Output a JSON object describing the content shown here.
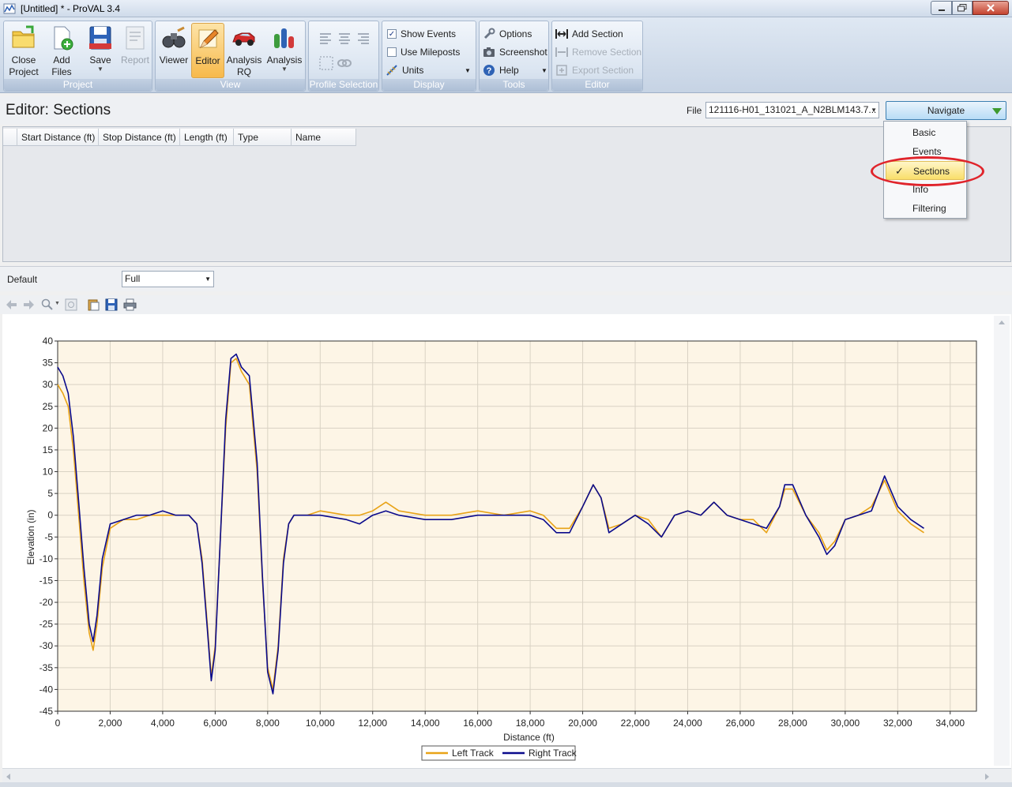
{
  "window": {
    "title": "[Untitled] * - ProVAL 3.4"
  },
  "ribbon": {
    "groups": {
      "project": "Project",
      "view": "View",
      "profile_selection": "Profile Selection",
      "display": "Display",
      "tools": "Tools",
      "editor": "Editor"
    },
    "close_project": [
      "Close",
      "Project"
    ],
    "add_files": "Add Files",
    "save": "Save",
    "report": "Report",
    "viewer": "Viewer",
    "editor": "Editor",
    "analysis_rq": [
      "Analysis",
      "RQ"
    ],
    "analysis": "Analysis",
    "show_events": "Show Events",
    "show_events_checked": true,
    "use_mileposts": "Use Mileposts",
    "use_mileposts_checked": false,
    "units": "Units",
    "options": "Options",
    "screenshot": "Screenshot",
    "help": "Help",
    "add_section": "Add Section",
    "remove_section": "Remove Section",
    "export_section": "Export Section"
  },
  "editor": {
    "title": "Editor: Sections",
    "file_label": "File",
    "file_value": "121116-H01_131021_A_N2BLM143.7...",
    "navigate_label": "Navigate",
    "columns": [
      "Start Distance (ft)",
      "Stop Distance (ft)",
      "Length (ft)",
      "Type",
      "Name"
    ]
  },
  "navigate_menu": {
    "items": [
      "Basic",
      "Events",
      "Sections",
      "Info",
      "Filtering"
    ],
    "selected": "Sections"
  },
  "default_row": {
    "label": "Default",
    "value": "Full"
  },
  "colors": {
    "left_track": "#e8a317",
    "right_track": "#0a0a8c",
    "plot_bg": "#fdf5e6",
    "active_tab": "#f7b94b",
    "highlight_circle": "#e0242b"
  },
  "chart_data": {
    "type": "line",
    "xlabel": "Distance (ft)",
    "ylabel": "Elevation (in)",
    "xlim": [
      0,
      35000
    ],
    "ylim": [
      -45,
      40
    ],
    "xticks": [
      0,
      2000,
      4000,
      6000,
      8000,
      10000,
      12000,
      14000,
      16000,
      18000,
      20000,
      22000,
      24000,
      26000,
      28000,
      30000,
      32000,
      34000
    ],
    "xtick_labels": [
      "0",
      "2,000",
      "4,000",
      "6,000",
      "8,000",
      "10,000",
      "12,000",
      "14,000",
      "16,000",
      "18,000",
      "20,000",
      "22,000",
      "24,000",
      "26,000",
      "28,000",
      "30,000",
      "32,000",
      "34,000"
    ],
    "yticks": [
      40,
      35,
      30,
      25,
      20,
      15,
      10,
      5,
      0,
      -5,
      -10,
      -15,
      -20,
      -25,
      -30,
      -35,
      -40,
      -45
    ],
    "grid": true,
    "legend": "bottom-center",
    "series": [
      {
        "name": "Left Track",
        "color": "#e8a317",
        "x": [
          0,
          200,
          400,
          600,
          800,
          1000,
          1200,
          1350,
          1500,
          1700,
          2000,
          2500,
          3000,
          3500,
          4000,
          4500,
          5000,
          5300,
          5500,
          5700,
          5850,
          6000,
          6200,
          6400,
          6600,
          6800,
          7000,
          7300,
          7600,
          7800,
          8000,
          8200,
          8400,
          8600,
          8800,
          9000,
          9500,
          10000,
          11000,
          11500,
          12000,
          12500,
          13000,
          14000,
          15000,
          16000,
          17000,
          18000,
          18500,
          19000,
          19500,
          20000,
          20400,
          20700,
          21000,
          21500,
          22000,
          22500,
          23000,
          23500,
          24000,
          24500,
          25000,
          25500,
          26000,
          26500,
          27000,
          27500,
          27700,
          28000,
          28500,
          29000,
          29300,
          29600,
          30000,
          30500,
          31000,
          31500,
          32000,
          32500,
          33000
        ],
        "y": [
          30,
          28,
          25,
          15,
          0,
          -15,
          -27,
          -31,
          -25,
          -12,
          -3,
          -1,
          -1,
          0,
          0,
          0,
          0,
          -2,
          -10,
          -25,
          -37,
          -30,
          -5,
          20,
          35,
          36,
          33,
          30,
          10,
          -15,
          -35,
          -40,
          -30,
          -10,
          -2,
          0,
          0,
          1,
          0,
          0,
          1,
          3,
          1,
          0,
          0,
          1,
          0,
          1,
          0,
          -3,
          -3,
          2,
          7,
          4,
          -3,
          -2,
          0,
          -1,
          -5,
          0,
          1,
          0,
          3,
          0,
          -1,
          -1,
          -4,
          2,
          6,
          6,
          0,
          -4,
          -8,
          -6,
          -1,
          0,
          2,
          8,
          1,
          -2,
          -4
        ]
      },
      {
        "name": "Right Track",
        "color": "#0a0a8c",
        "x": [
          0,
          200,
          400,
          600,
          800,
          1000,
          1200,
          1350,
          1500,
          1700,
          2000,
          2500,
          3000,
          3500,
          4000,
          4500,
          5000,
          5300,
          5500,
          5700,
          5850,
          6000,
          6200,
          6400,
          6600,
          6800,
          7000,
          7300,
          7600,
          7800,
          8000,
          8200,
          8400,
          8600,
          8800,
          9000,
          9500,
          10000,
          11000,
          11500,
          12000,
          12500,
          13000,
          14000,
          15000,
          16000,
          17000,
          18000,
          18500,
          19000,
          19500,
          20000,
          20400,
          20700,
          21000,
          21500,
          22000,
          22500,
          23000,
          23500,
          24000,
          24500,
          25000,
          25500,
          26000,
          26500,
          27000,
          27500,
          27700,
          28000,
          28500,
          29000,
          29300,
          29600,
          30000,
          30500,
          31000,
          31500,
          32000,
          32500,
          33000
        ],
        "y": [
          34,
          32,
          28,
          18,
          3,
          -12,
          -25,
          -29,
          -23,
          -10,
          -2,
          -1,
          0,
          0,
          1,
          0,
          0,
          -2,
          -11,
          -26,
          -38,
          -31,
          -5,
          22,
          36,
          37,
          34,
          32,
          12,
          -14,
          -36,
          -41,
          -31,
          -11,
          -2,
          0,
          0,
          0,
          -1,
          -2,
          0,
          1,
          0,
          -1,
          -1,
          0,
          0,
          0,
          -1,
          -4,
          -4,
          2,
          7,
          4,
          -4,
          -2,
          0,
          -2,
          -5,
          0,
          1,
          0,
          3,
          0,
          -1,
          -2,
          -3,
          2,
          7,
          7,
          0,
          -5,
          -9,
          -7,
          -1,
          0,
          1,
          9,
          2,
          -1,
          -3
        ]
      }
    ]
  }
}
